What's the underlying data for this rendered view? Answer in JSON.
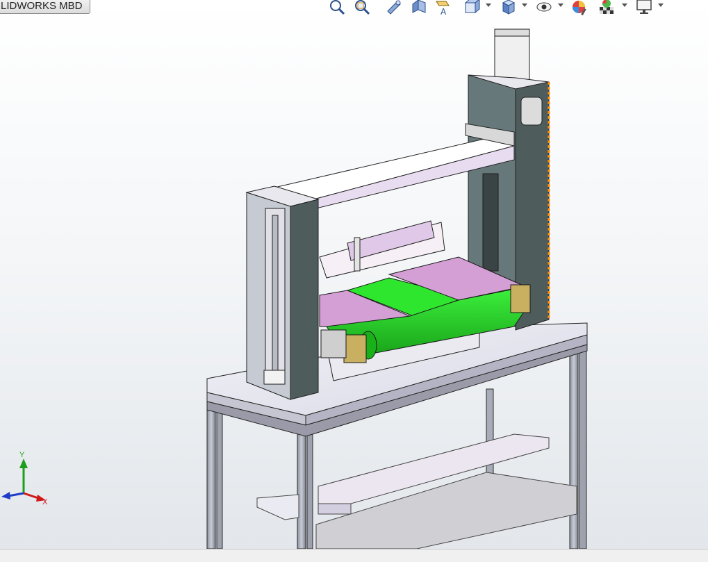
{
  "document_tab": {
    "label": "LIDWORKS MBD"
  },
  "heads_up_toolbar": {
    "buttons": [
      {
        "name": "zoom-to-fit-icon"
      },
      {
        "name": "zoom-to-area-icon"
      },
      {
        "name": "previous-view-icon"
      },
      {
        "name": "section-view-icon"
      },
      {
        "name": "dynamic-annotation-views-icon"
      },
      {
        "name": "view-orientation-icon",
        "has_dropdown": true
      },
      {
        "name": "display-style-icon",
        "has_dropdown": true
      },
      {
        "name": "hide-show-items-icon",
        "has_dropdown": true
      },
      {
        "name": "edit-appearance-icon"
      },
      {
        "name": "apply-scene-icon",
        "has_dropdown": true
      },
      {
        "name": "view-settings-icon",
        "has_dropdown": true
      }
    ]
  },
  "triad": {
    "x_label": "X",
    "y_label": "Y",
    "z_label": "Z"
  },
  "model": {
    "description": "3D assembly: frame-mounted conveyor with gantry"
  },
  "colors": {
    "belt": "#2ee62e",
    "pink_plates": "#d49fd4",
    "side_plates": "#4f5c5c",
    "frame": "#b8bcc6",
    "highlight_edge": "#ff8c00"
  }
}
